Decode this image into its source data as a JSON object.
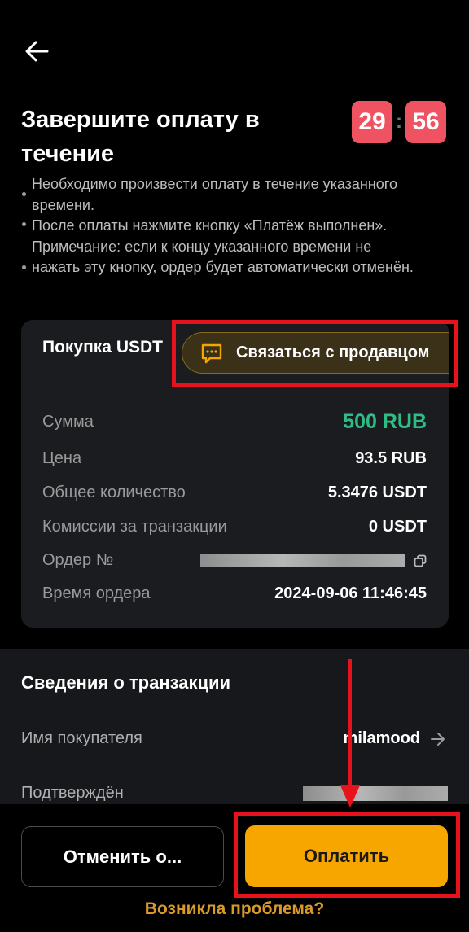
{
  "header": {
    "back_icon": "arrow-left-icon"
  },
  "title": "Завершите оплату в течение",
  "timer": {
    "minutes": "29",
    "separator": ":",
    "seconds": "56",
    "color": "#ef5260"
  },
  "notes": [
    "Необходимо произвести оплату в течение указанного времени.",
    "После оплаты нажмите кнопку «Платёж выполнен». Примечание: если к концу указанного времени не",
    "нажать эту кнопку, ордер будет автоматически отменён."
  ],
  "order_card": {
    "title": "Покупка USDT",
    "contact_button": {
      "label": "Связаться с продавцом",
      "icon": "chat-icon"
    },
    "rows": [
      {
        "label": "Сумма",
        "value": "500 RUB"
      },
      {
        "label": "Цена",
        "value": "93.5 RUB"
      },
      {
        "label": "Общее количество",
        "value": "5.3476 USDT"
      },
      {
        "label": "Комиссии за транзакции",
        "value": "0 USDT"
      },
      {
        "label": "Ордер №",
        "value": "",
        "copy_icon": "copy-icon"
      },
      {
        "label": "Время ордера",
        "value": "2024-09-06 11:46:45"
      }
    ]
  },
  "transaction": {
    "title": "Сведения о транзакции",
    "buyer_label": "Имя покупателя",
    "buyer_value": "milamood",
    "confirmed_label": "Подтверждён"
  },
  "actions": {
    "cancel_label": "Отменить о...",
    "pay_label": "Оплатить",
    "problem_label": "Возникла проблема?"
  },
  "colors": {
    "accent": "#f7a600",
    "success": "#2ebd85",
    "highlight": "#e8121c"
  }
}
